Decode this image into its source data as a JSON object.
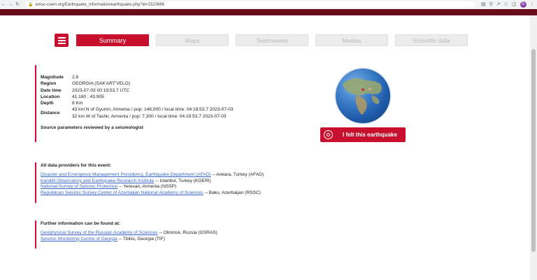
{
  "browser": {
    "url": "emsc-csem.org/Earthquake_information/earthquake.php?id=1523666",
    "avatar_letter": "G"
  },
  "tabs": [
    {
      "label": "Summary",
      "active": true
    },
    {
      "label": "Maps",
      "active": false
    },
    {
      "label": "Testimonies",
      "active": false
    },
    {
      "label": "Medias",
      "active": false
    },
    {
      "label": "Scientific data",
      "active": false
    }
  ],
  "params": {
    "magnitude": {
      "label": "Magnitude",
      "value": "2.6"
    },
    "region": {
      "label": "Region",
      "value": "GEORGIA (SAK'ART'VELO)"
    },
    "datetime": {
      "label": "Date time",
      "value": "2023-07-03 00:19:53.7 UTC"
    },
    "location": {
      "label": "Location",
      "value": "41.180 ; 43.905"
    },
    "depth": {
      "label": "Depth",
      "value": "8 Km"
    },
    "distance": {
      "label": "Distance",
      "line1": "43 km N of Gyumri, Armenia / pop: 148,000 / local time: 04:19:53.7 2023-07-03",
      "line2": "32 km W of Tashir, Armenia / pop: 7,300 / local time: 04:19:53.7 2023-07-03"
    },
    "reviewed": "Source parameters reviewed by a seismologist"
  },
  "felt_button": "I felt this earthquake",
  "providers": {
    "heading": "All data providers for this event:",
    "items": [
      {
        "name": "Disaster and Emergency Management Presidency, Earthquake Department (AFAD)",
        "suffix": "-- Ankara, Turkey (AFAD)"
      },
      {
        "name": "Kandilli Observatory and Earthquake Research Institute",
        "suffix": "-- Istanbul, Turkey (KOERI)"
      },
      {
        "name": "National Survey of Seismic Protection",
        "suffix": "-- Yerevan, Armenia (NSSP)"
      },
      {
        "name": "Republican Seismic Survey Center of Azerbaijan National Academy of Sciences",
        "suffix": "-- Baku, Azerbaijan (RSSC)"
      }
    ]
  },
  "further": {
    "heading": "Further information can be found at:",
    "items": [
      {
        "name": "Geophysical Survey of the Russian Academy of Sciences",
        "suffix": "-- Obninsk, Russia (GSRAS)"
      },
      {
        "name": "Seismic Monitoring Centre of Georgia",
        "suffix": "-- Tbilisi, Georgia (TIF)"
      }
    ]
  },
  "colors": {
    "accent": "#c8102e",
    "band": "#6b0c1a",
    "link": "#3a67c7"
  }
}
